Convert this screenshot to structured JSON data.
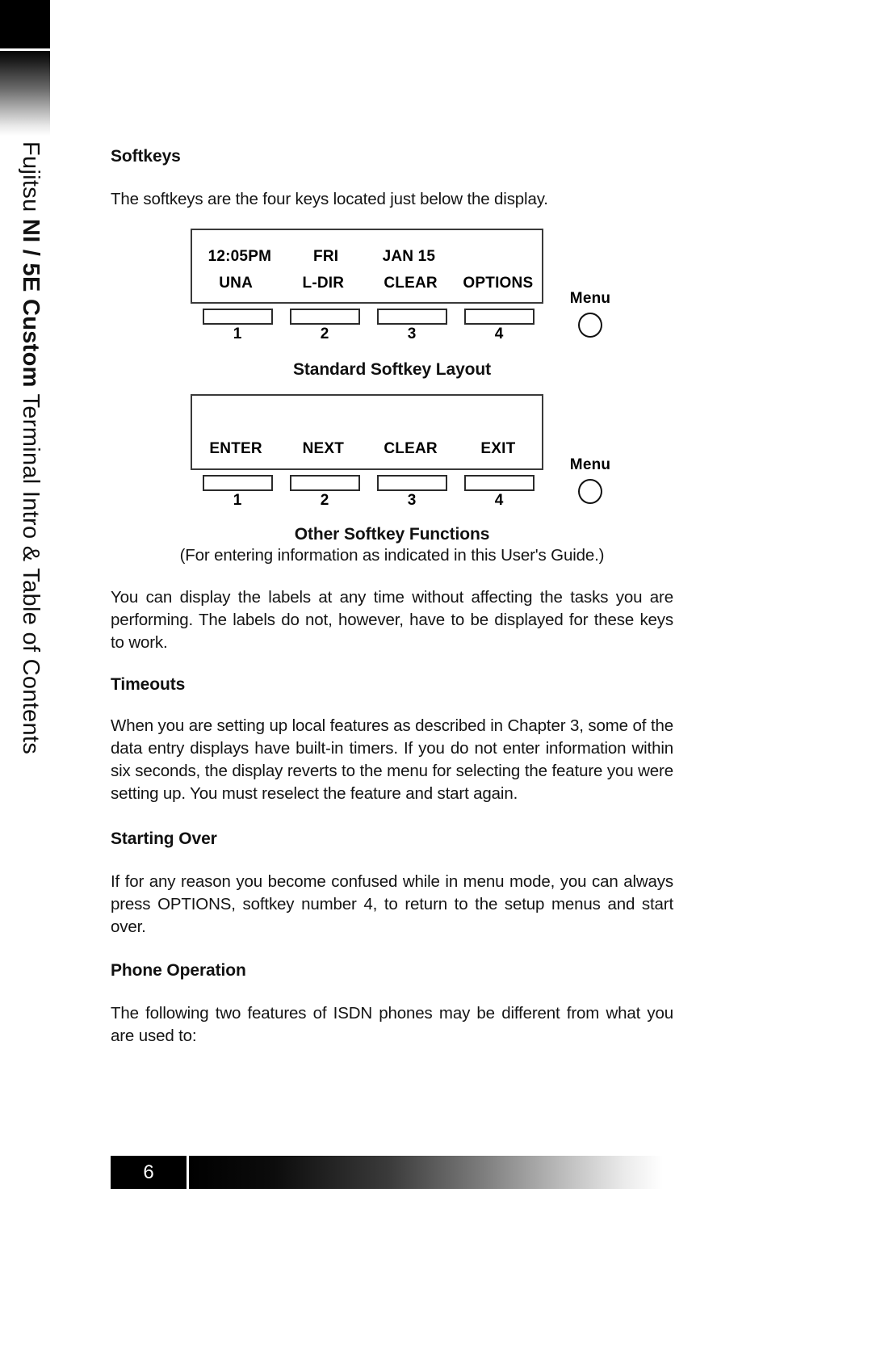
{
  "spine": {
    "prefix": "Fujitsu ",
    "bold": "NI / 5E Custom",
    "suffix": " Terminal Intro & Table of Contents"
  },
  "sections": {
    "softkeys_heading": "Softkeys",
    "softkeys_intro": "The softkeys are the four keys located just below the display.",
    "softkeys_body": "You can display the labels at any time without affecting the tasks you are performing.  The labels do not, however, have to be displayed for these keys to work.",
    "timeouts_heading": "Timeouts",
    "timeouts_body": "When you are setting up local features as described in Chapter 3, some of the data entry displays have built-in timers.  If you do not enter information within six seconds, the display reverts to the menu for selecting the feature you were setting up.  You must reselect the feature and start again.",
    "starting_over_heading": "Starting Over",
    "starting_over_body": "If for any reason you become confused while in menu mode, you can always press OPTIONS, softkey number 4, to return to the setup menus and start over.",
    "phone_operation_heading": "Phone Operation",
    "phone_operation_body": "The following two features of ISDN phones may be different from what you are used to:"
  },
  "diagram_standard": {
    "status_line": [
      "12:05PM",
      "FRI",
      "JAN 15",
      ""
    ],
    "softkey_labels": [
      "UNA",
      "L-DIR",
      "CLEAR",
      "OPTIONS"
    ],
    "key_numbers": [
      "1",
      "2",
      "3",
      "4"
    ],
    "menu_label": "Menu",
    "caption": "Standard Softkey Layout"
  },
  "diagram_other": {
    "softkey_labels": [
      "ENTER",
      "NEXT",
      "CLEAR",
      "EXIT"
    ],
    "key_numbers": [
      "1",
      "2",
      "3",
      "4"
    ],
    "menu_label": "Menu",
    "caption": "Other Softkey Functions",
    "caption_sub": "(For entering information as indicated in this User's Guide.)"
  },
  "footer": {
    "page_number": "6"
  },
  "colors": {
    "ink": "#111111",
    "rule": "#2b2b2b",
    "paper": "#ffffff"
  }
}
